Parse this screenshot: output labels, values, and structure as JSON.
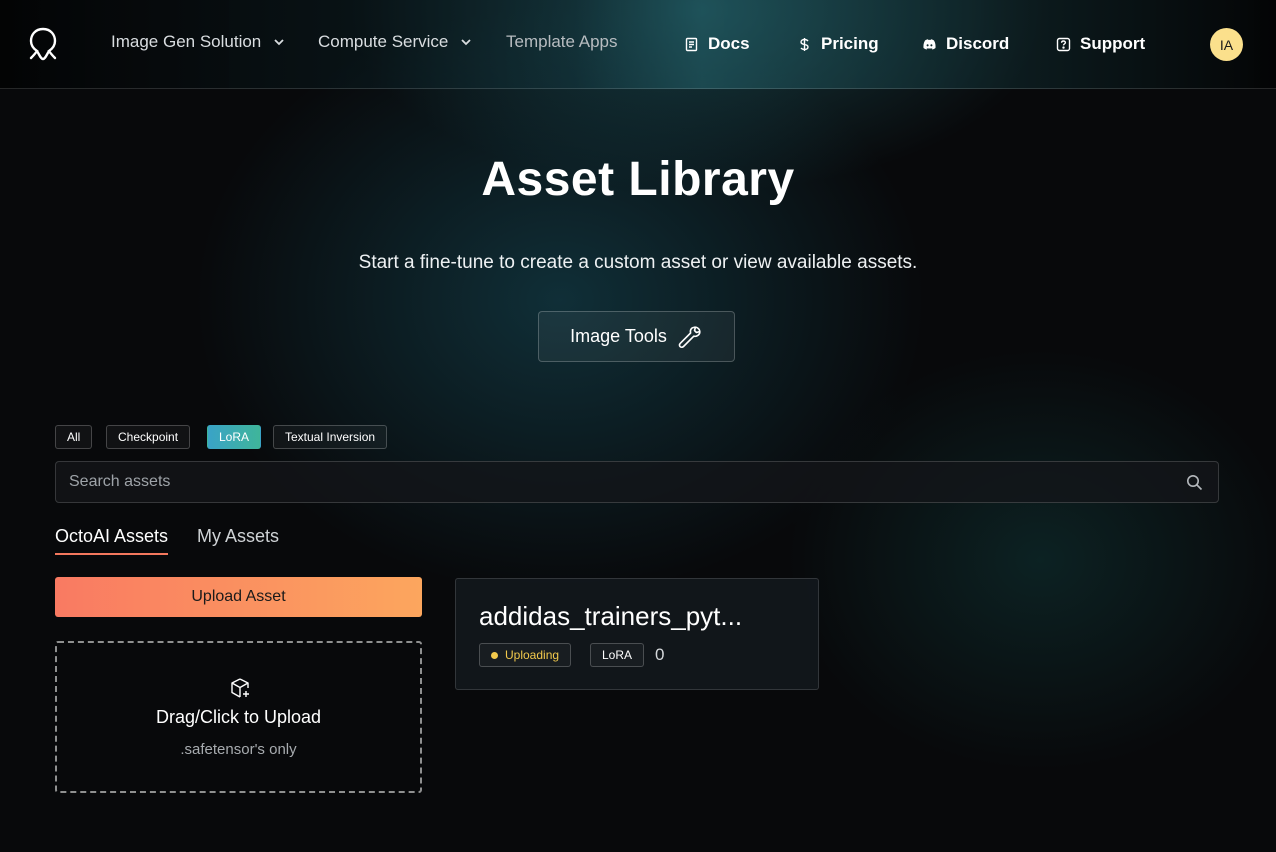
{
  "nav": {
    "menus": [
      {
        "label": "Image Gen Solution"
      },
      {
        "label": "Compute Service"
      }
    ],
    "template_apps": "Template Apps",
    "links": [
      {
        "label": "Docs",
        "icon": "document-icon"
      },
      {
        "label": "Pricing",
        "icon": "dollar-icon"
      },
      {
        "label": "Discord",
        "icon": "discord-icon"
      },
      {
        "label": "Support",
        "icon": "help-square-icon"
      }
    ],
    "avatar_initials": "IA"
  },
  "hero": {
    "title": "Asset Library",
    "subtitle": "Start a fine-tune to create a custom asset or view available assets.",
    "tools_button": "Image Tools"
  },
  "filters": [
    {
      "label": "All",
      "active": false
    },
    {
      "label": "Checkpoint",
      "active": false
    },
    {
      "label": "LoRA",
      "active": true
    },
    {
      "label": "Textual Inversion",
      "active": false
    }
  ],
  "search": {
    "placeholder": "Search assets",
    "value": ""
  },
  "tabs": [
    {
      "label": "OctoAI Assets",
      "active": true
    },
    {
      "label": "My Assets",
      "active": false
    }
  ],
  "upload": {
    "button": "Upload Asset",
    "drop_title": "Drag/Click to Upload",
    "drop_sub": ".safetensor's only"
  },
  "assets": [
    {
      "name": "addidas_trainers_pyt...",
      "status": "Uploading",
      "type": "LoRA",
      "count": "0"
    }
  ],
  "colors": {
    "accent_gradient_start": "#f97a62",
    "accent_gradient_end": "#fca65e",
    "lora_chip_start": "#3aa3c7",
    "lora_chip_end": "#3fb59a",
    "status_uploading": "#f2c94c",
    "avatar_bg": "#fbe08c"
  }
}
